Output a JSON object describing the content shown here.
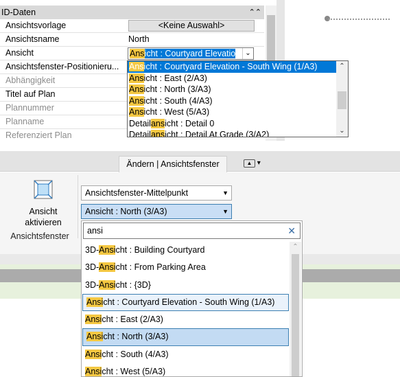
{
  "properties": {
    "header": "ID-Daten",
    "rows": [
      {
        "label": "Ansichtsvorlage",
        "value": "<Keine Auswahl>"
      },
      {
        "label": "Ansichtsname",
        "value": "North"
      },
      {
        "label": "Ansicht",
        "value": "Ansicht : Courtyard Elevatio"
      },
      {
        "label": "Ansichtsfenster-Positionieru...",
        "value": ""
      },
      {
        "label": "Abhängigkeit",
        "value": ""
      },
      {
        "label": "Titel auf Plan",
        "value": ""
      },
      {
        "label": "Plannummer",
        "value": ""
      },
      {
        "label": "Planname",
        "value": ""
      },
      {
        "label": "Referenziert Plan",
        "value": ""
      }
    ]
  },
  "dropdown_top": {
    "items": [
      {
        "hl": "Ans",
        "rest": "icht : Courtyard Elevation - South Wing (1/A3)"
      },
      {
        "hl": "Ans",
        "rest": "icht : East (2/A3)"
      },
      {
        "hl": "Ans",
        "rest": "icht : North (3/A3)"
      },
      {
        "hl": "Ans",
        "rest": "icht : South (4/A3)"
      },
      {
        "hl": "Ans",
        "rest": "icht : West (5/A3)"
      },
      {
        "pre": "Detail",
        "hl": "ans",
        "rest": "icht : Detail 0"
      },
      {
        "pre": "Detail",
        "hl": "ans",
        "rest": "icht : Detail At Grade (3/A2)"
      }
    ]
  },
  "ribbon": {
    "tab_label": "Ändern | Ansichtsfenster",
    "activate_button": "Ansicht aktivieren",
    "panel_label": "Ansichtsfenster",
    "combo_position": "Ansichtsfenster-Mittelpunkt",
    "combo_view": "Ansicht : North (3/A3)"
  },
  "search": {
    "value": "ansi",
    "clear_icon": "close-icon"
  },
  "dropdown_bottom": {
    "items": [
      {
        "pre": "3D-",
        "hl": "Ansi",
        "rest": "cht : Building Courtyard"
      },
      {
        "pre": "3D-",
        "hl": "Ansi",
        "rest": "cht : From Parking Area"
      },
      {
        "pre": "3D-",
        "hl": "Ansi",
        "rest": "cht : {3D}"
      },
      {
        "pre": "",
        "hl": "Ansi",
        "rest": "cht : Courtyard Elevation - South Wing (1/A3)"
      },
      {
        "pre": "",
        "hl": "Ansi",
        "rest": "cht : East (2/A3)"
      },
      {
        "pre": "",
        "hl": "Ansi",
        "rest": "cht : North (3/A3)"
      },
      {
        "pre": "",
        "hl": "Ansi",
        "rest": "cht : South (4/A3)"
      },
      {
        "pre": "",
        "hl": "Ansi",
        "rest": "cht : West (5/A3)"
      }
    ]
  }
}
